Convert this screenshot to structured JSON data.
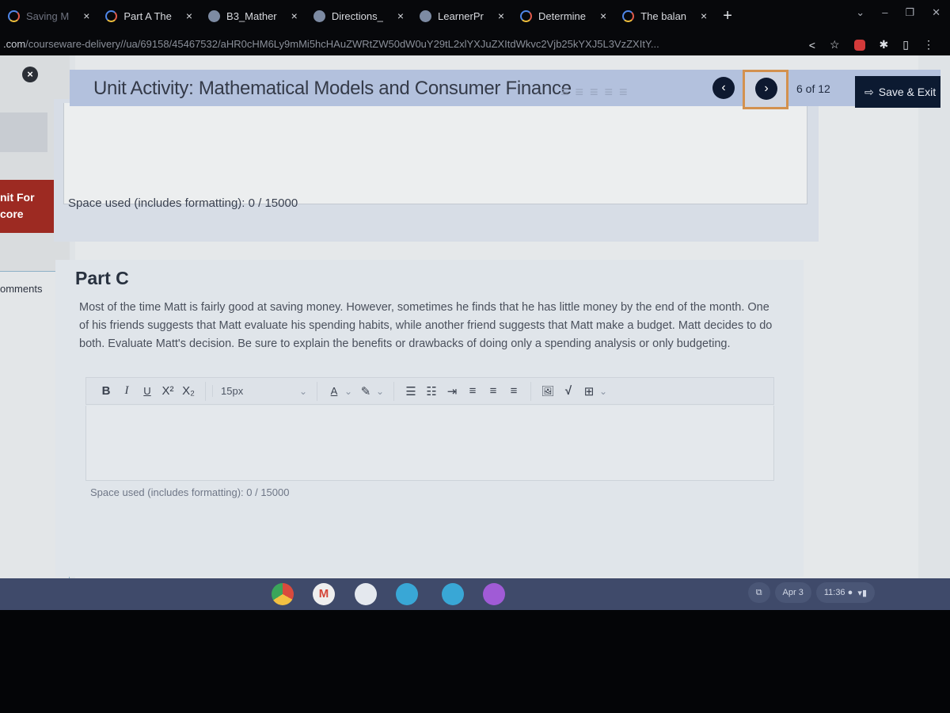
{
  "browser": {
    "tabs": [
      {
        "label": "Saving M",
        "icon": "google-icon",
        "dim": true
      },
      {
        "label": "Part A The",
        "icon": "google-icon",
        "dim": false
      },
      {
        "label": "B3_Mather",
        "icon": "edmentum-icon",
        "dim": false
      },
      {
        "label": "Directions_",
        "icon": "edmentum-icon",
        "dim": false
      },
      {
        "label": "LearnerPr",
        "icon": "edmentum-icon",
        "dim": false
      },
      {
        "label": "Determine",
        "icon": "google-icon",
        "dim": false
      },
      {
        "label": "The balan",
        "icon": "google-icon",
        "dim": false
      }
    ],
    "tab_close": "×",
    "new_tab": "+",
    "url_domain": ".com",
    "url_path": "/courseware-delivery//ua/69158/45467532/aHR0cHM6Ly9mMi5hcHAuZWRtZW50dW0uY29tL2xlYXJuZXItdWkvc2Vjb25kYXJ5L3VzZXItY..."
  },
  "sidebar": {
    "close_glyph": "×",
    "submit_label": "nit For\ncore",
    "comments_label": "omments"
  },
  "header": {
    "title": "Unit Activity: Mathematical Models and Consumer Finance",
    "prev_glyph": "‹",
    "next_glyph": "›",
    "page_current": 6,
    "page_total": 12,
    "page_label": "6  of  12",
    "save_exit_label": "Save & Exit"
  },
  "part_b": {
    "space_used": "Space used (includes formatting): 0 / 15000"
  },
  "part_c": {
    "title": "Part C",
    "prompt": "Most of the time Matt is fairly good at saving money. However, sometimes he finds that he has little money by the end of the month. One of his friends suggests that Matt evaluate his spending habits, while another friend suggests that Matt make a budget. Matt decides to do both. Evaluate Matt's decision. Be sure to explain the benefits or drawbacks of doing only a spending analysis or only budgeting.",
    "toolbar": {
      "bold": "B",
      "italic": "I",
      "underline": "U",
      "superscript": "X²",
      "subscript": "X₂",
      "font_size": "15px",
      "font_color": "A",
      "highlight": "✎",
      "bullet_list": "☰",
      "numbered_list": "☷",
      "indent": "⇥",
      "align_left": "≡",
      "align_center": "≡",
      "align_right": "≡",
      "image": "🖼",
      "equation": "√",
      "table": "⊞"
    },
    "answer_value": "",
    "space_used": "Space used (includes formatting): 0 / 15000"
  },
  "shelf": {
    "apps": [
      {
        "name": "chrome",
        "color": "#e7e7e7"
      },
      {
        "name": "gmail",
        "color": "#eeeeee"
      },
      {
        "name": "docs",
        "color": "#e4e8ee"
      },
      {
        "name": "files-blue",
        "color": "#39a7d6"
      },
      {
        "name": "files",
        "color": "#39a7d6"
      },
      {
        "name": "app-purple",
        "color": "#a05bd6"
      }
    ],
    "date": "Apr 3",
    "time": "11:36"
  }
}
